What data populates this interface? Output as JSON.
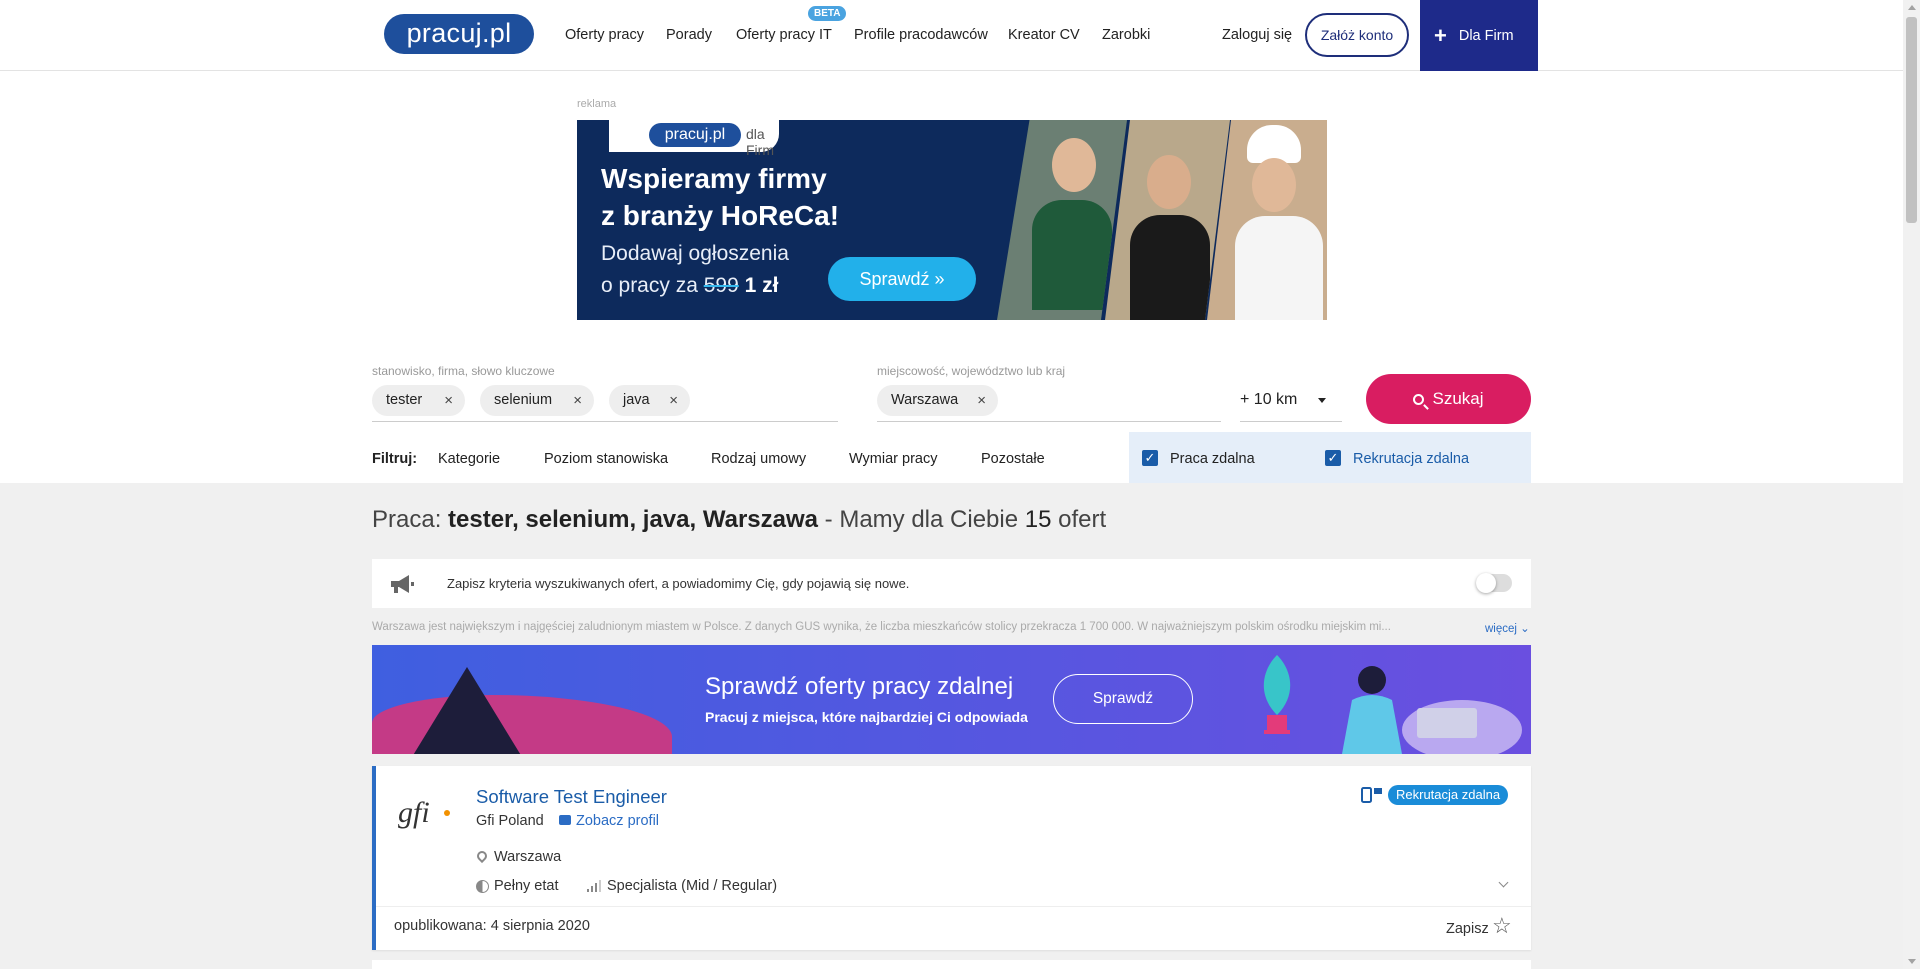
{
  "header": {
    "logo": "pracuj.pl",
    "nav": [
      {
        "label": "Oferty pracy"
      },
      {
        "label": "Porady"
      },
      {
        "label": "Oferty pracy IT",
        "badge": "BETA"
      },
      {
        "label": "Profile pracodawców"
      },
      {
        "label": "Kreator CV"
      },
      {
        "label": "Zarobki"
      }
    ],
    "login": "Zaloguj się",
    "register": "Załóż konto",
    "for_firms": "Dla Firm"
  },
  "ad": {
    "label": "reklama",
    "brand": "pracuj.pl",
    "brand_suffix": "dla Firm",
    "headline_1": "Wspieramy firmy",
    "headline_2": "z branży HoReCa!",
    "sub_1": "Dodawaj ogłoszenia",
    "sub_2_prefix": "o pracy za ",
    "old_price": "599",
    "new_price": " 1 zł",
    "button": "Sprawdź »"
  },
  "search": {
    "keyword_label": "stanowisko, firma, słowo kluczowe",
    "keywords": [
      "tester",
      "selenium",
      "java"
    ],
    "location_label": "miejscowość, województwo lub kraj",
    "location": "Warszawa",
    "radius": "+ 10 km",
    "button": "Szukaj",
    "remove_glyph": "×"
  },
  "filters": {
    "label": "Filtruj:",
    "items": [
      "Kategorie",
      "Poziom stanowiska",
      "Rodzaj umowy",
      "Wymiar pracy",
      "Pozostałe"
    ],
    "remote_work": {
      "label": "Praca zdalna",
      "checked": true
    },
    "remote_recruitment": {
      "label": "Rekrutacja zdalna",
      "checked": true
    }
  },
  "results": {
    "prefix": "Praca: ",
    "query": "tester, selenium, java, Warszawa",
    "mid": " - Mamy dla Ciebie ",
    "count": "15",
    "suffix": " ofert"
  },
  "notify": {
    "text": "Zapisz kryteria wyszukiwanych ofert, a powiadomimy Cię, gdy pojawią się nowe.",
    "enabled": false
  },
  "seo": {
    "text": "Warszawa jest największym i najgęściej zaludnionym miastem w Polsce. Z danych GUS wynika, że liczba mieszkańców stolicy przekracza 1 700 000. W najważniejszym polskim ośrodku miejskim mi...",
    "more": "więcej"
  },
  "remote_banner": {
    "title": "Sprawdź oferty pracy zdalnej",
    "subtitle": "Pracuj z miejsca, które najbardziej Ci odpowiada",
    "button": "Sprawdź"
  },
  "offer": {
    "logo_text": "gfi",
    "title": "Software Test Engineer",
    "company": "Gfi Poland",
    "profile_link": "Zobacz profil",
    "location": "Warszawa",
    "employment": "Pełny etat",
    "level": "Specjalista (Mid / Regular)",
    "badge": "Rekrutacja zdalna",
    "published": "opublikowana: 4 sierpnia 2020",
    "save": "Zapisz",
    "star": "☆"
  },
  "colors": {
    "brand_blue": "#1e4f9c",
    "search_pink": "#d91d61",
    "link_blue": "#1a5ca8",
    "firm_navy": "#1e2a8a"
  }
}
